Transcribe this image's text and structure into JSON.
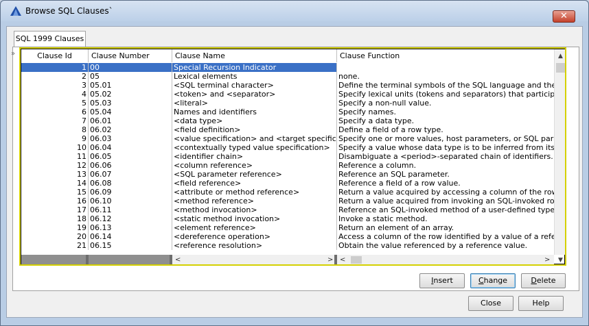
{
  "window": {
    "title": "Browse SQL Clauses`"
  },
  "tab": {
    "label": "SQL 1999 Clauses"
  },
  "side_marker": "»",
  "grid": {
    "headers": {
      "id": "Clause Id",
      "number": "Clause Number",
      "name": "Clause Name",
      "function": "Clause Function"
    },
    "rows": [
      {
        "id": "1",
        "number": "00",
        "name": "Special Recursion Indicator",
        "function": ""
      },
      {
        "id": "2",
        "number": "05",
        "name": "Lexical elements",
        "function": "none."
      },
      {
        "id": "3",
        "number": "05.01",
        "name": "<SQL terminal character>",
        "function": "Define the terminal symbols of the SQL language and the eleme"
      },
      {
        "id": "4",
        "number": "05.02",
        "name": "<token> and <separator>",
        "function": "Specify lexical units (tokens and separators) that participate in S"
      },
      {
        "id": "5",
        "number": "05.03",
        "name": "<literal>",
        "function": "Specify a non-null value."
      },
      {
        "id": "6",
        "number": "05.04",
        "name": "Names and identifiers",
        "function": "Specify names."
      },
      {
        "id": "7",
        "number": "06.01",
        "name": "<data type>",
        "function": "Specify a data type."
      },
      {
        "id": "8",
        "number": "06.02",
        "name": "<field definition>",
        "function": "Define a field of a row type."
      },
      {
        "id": "9",
        "number": "06.03",
        "name": "<value specification> and <target specification>",
        "function": "Specify one or more values, host parameters, or SQL paramete"
      },
      {
        "id": "10",
        "number": "06.04",
        "name": "<contextually typed value specification>",
        "function": "Specify a value whose data type is to be inferred from its conte"
      },
      {
        "id": "11",
        "number": "06.05",
        "name": "<identifier chain>",
        "function": "Disambiguate a <period>-separated chain of identifiers."
      },
      {
        "id": "12",
        "number": "06.06",
        "name": "<column reference>",
        "function": "Reference a column."
      },
      {
        "id": "13",
        "number": "06.07",
        "name": "<SQL parameter reference>",
        "function": "Reference an SQL parameter."
      },
      {
        "id": "14",
        "number": "06.08",
        "name": "<field reference>",
        "function": "Reference a field of a row value."
      },
      {
        "id": "15",
        "number": "06.09",
        "name": "<attribute or method reference>",
        "function": "Return a value acquired by accessing a column of the row ident"
      },
      {
        "id": "16",
        "number": "06.10",
        "name": "<method reference>",
        "function": "Return a value acquired from invoking an SQL-invoked routine t"
      },
      {
        "id": "17",
        "number": "06.11",
        "name": "<method invocation>",
        "function": "Reference an SQL-invoked method of a user-defined type value"
      },
      {
        "id": "18",
        "number": "06.12",
        "name": "<static method invocation>",
        "function": "Invoke a static method."
      },
      {
        "id": "19",
        "number": "06.13",
        "name": "<element reference>",
        "function": "Return an element of an array."
      },
      {
        "id": "20",
        "number": "06.14",
        "name": "<dereference operation>",
        "function": "Access a column of the row identified by a value of a reference"
      },
      {
        "id": "21",
        "number": "06.15",
        "name": "<reference resolution>",
        "function": "Obtain the value referenced by a reference value."
      }
    ],
    "selected_row": 0
  },
  "buttons": {
    "insert": {
      "first": "I",
      "rest": "nsert"
    },
    "change": {
      "first": "C",
      "rest": "hange"
    },
    "delete": {
      "first": "D",
      "rest": "elete"
    },
    "close": "Close",
    "help": "Help"
  },
  "colors": {
    "selection": "#3a70c6",
    "grid_border": "#d4d000"
  }
}
